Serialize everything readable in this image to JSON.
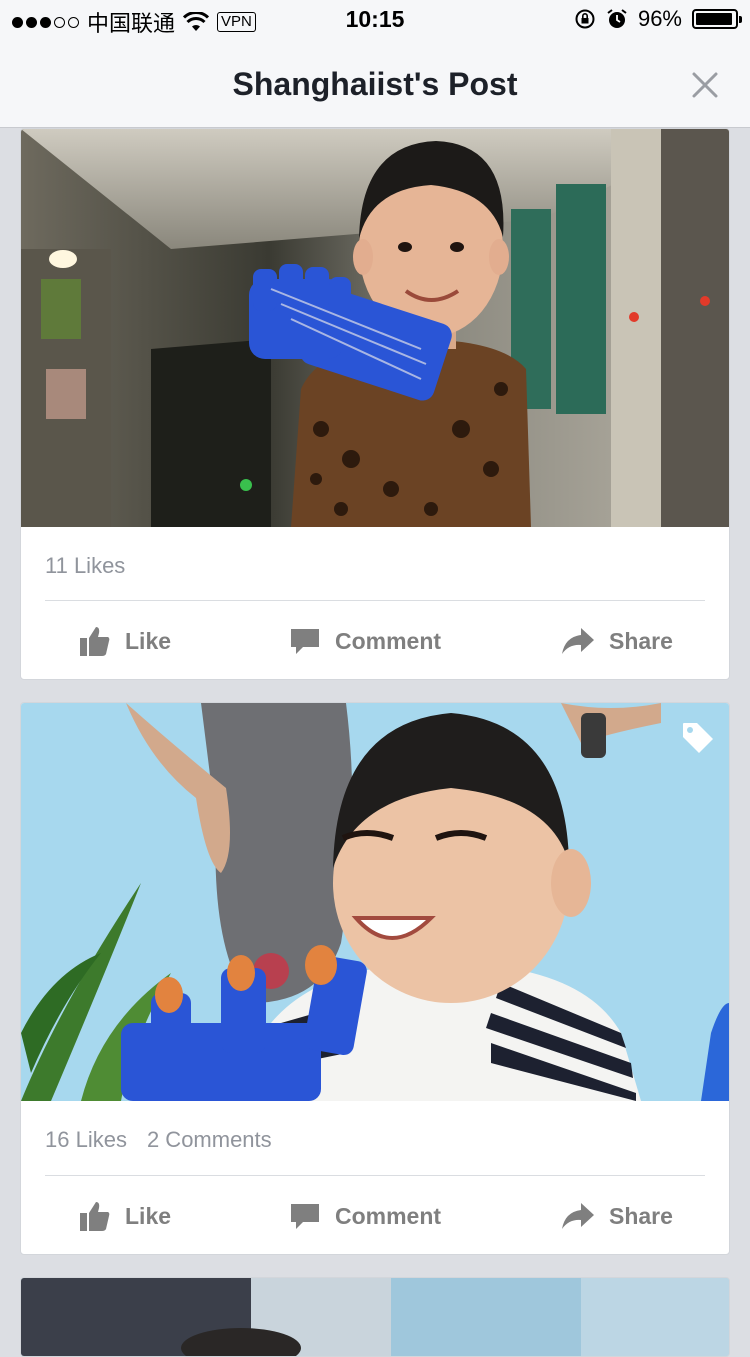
{
  "status_bar": {
    "carrier": "中国联通",
    "vpn": "VPN",
    "time": "10:15",
    "battery": "96%",
    "battery_level": 0.96,
    "signal_bars_filled": 3,
    "signal_bars_total": 5
  },
  "header": {
    "title": "Shanghaiist's Post"
  },
  "posts": [
    {
      "image_icons": [
        "photo"
      ],
      "likes": "11 Likes",
      "comments": "",
      "actions": {
        "like": "Like",
        "comment": "Comment",
        "share": "Share"
      }
    },
    {
      "image_icons": [
        "photo",
        "tag-icon"
      ],
      "likes": "16 Likes",
      "comments": "2 Comments",
      "actions": {
        "like": "Like",
        "comment": "Comment",
        "share": "Share"
      }
    }
  ],
  "colors": {
    "action_text": "#7f7f7f",
    "counts_text": "#90949c",
    "background": "#dcdee3",
    "header_bg": "#f6f7f9",
    "toy_hand": "#2a55d6"
  }
}
